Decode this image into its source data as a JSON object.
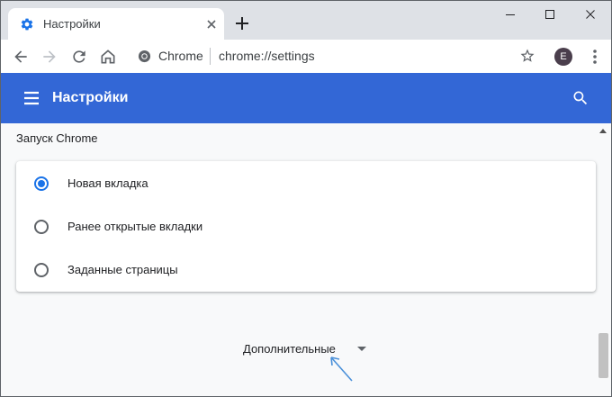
{
  "tab": {
    "title": "Настройки",
    "favicon": "gear-icon",
    "close_icon": "close-icon"
  },
  "window_controls": {
    "new_tab": "plus-icon",
    "minimize": "minimize-icon",
    "maximize": "maximize-icon",
    "close": "close-icon"
  },
  "toolbar": {
    "chip_label": "Chrome",
    "url": "chrome://settings",
    "avatar_letter": "E"
  },
  "header": {
    "title": "Настройки"
  },
  "section": {
    "title": "Запуск Chrome",
    "options": [
      {
        "label": "Новая вкладка",
        "checked": true
      },
      {
        "label": "Ранее открытые вкладки",
        "checked": false
      },
      {
        "label": "Заданные страницы",
        "checked": false
      }
    ]
  },
  "advanced": {
    "label": "Дополнительные"
  },
  "colors": {
    "header": "#3367d6",
    "accent": "#1a73e8",
    "annotation": "#4a90d9"
  }
}
